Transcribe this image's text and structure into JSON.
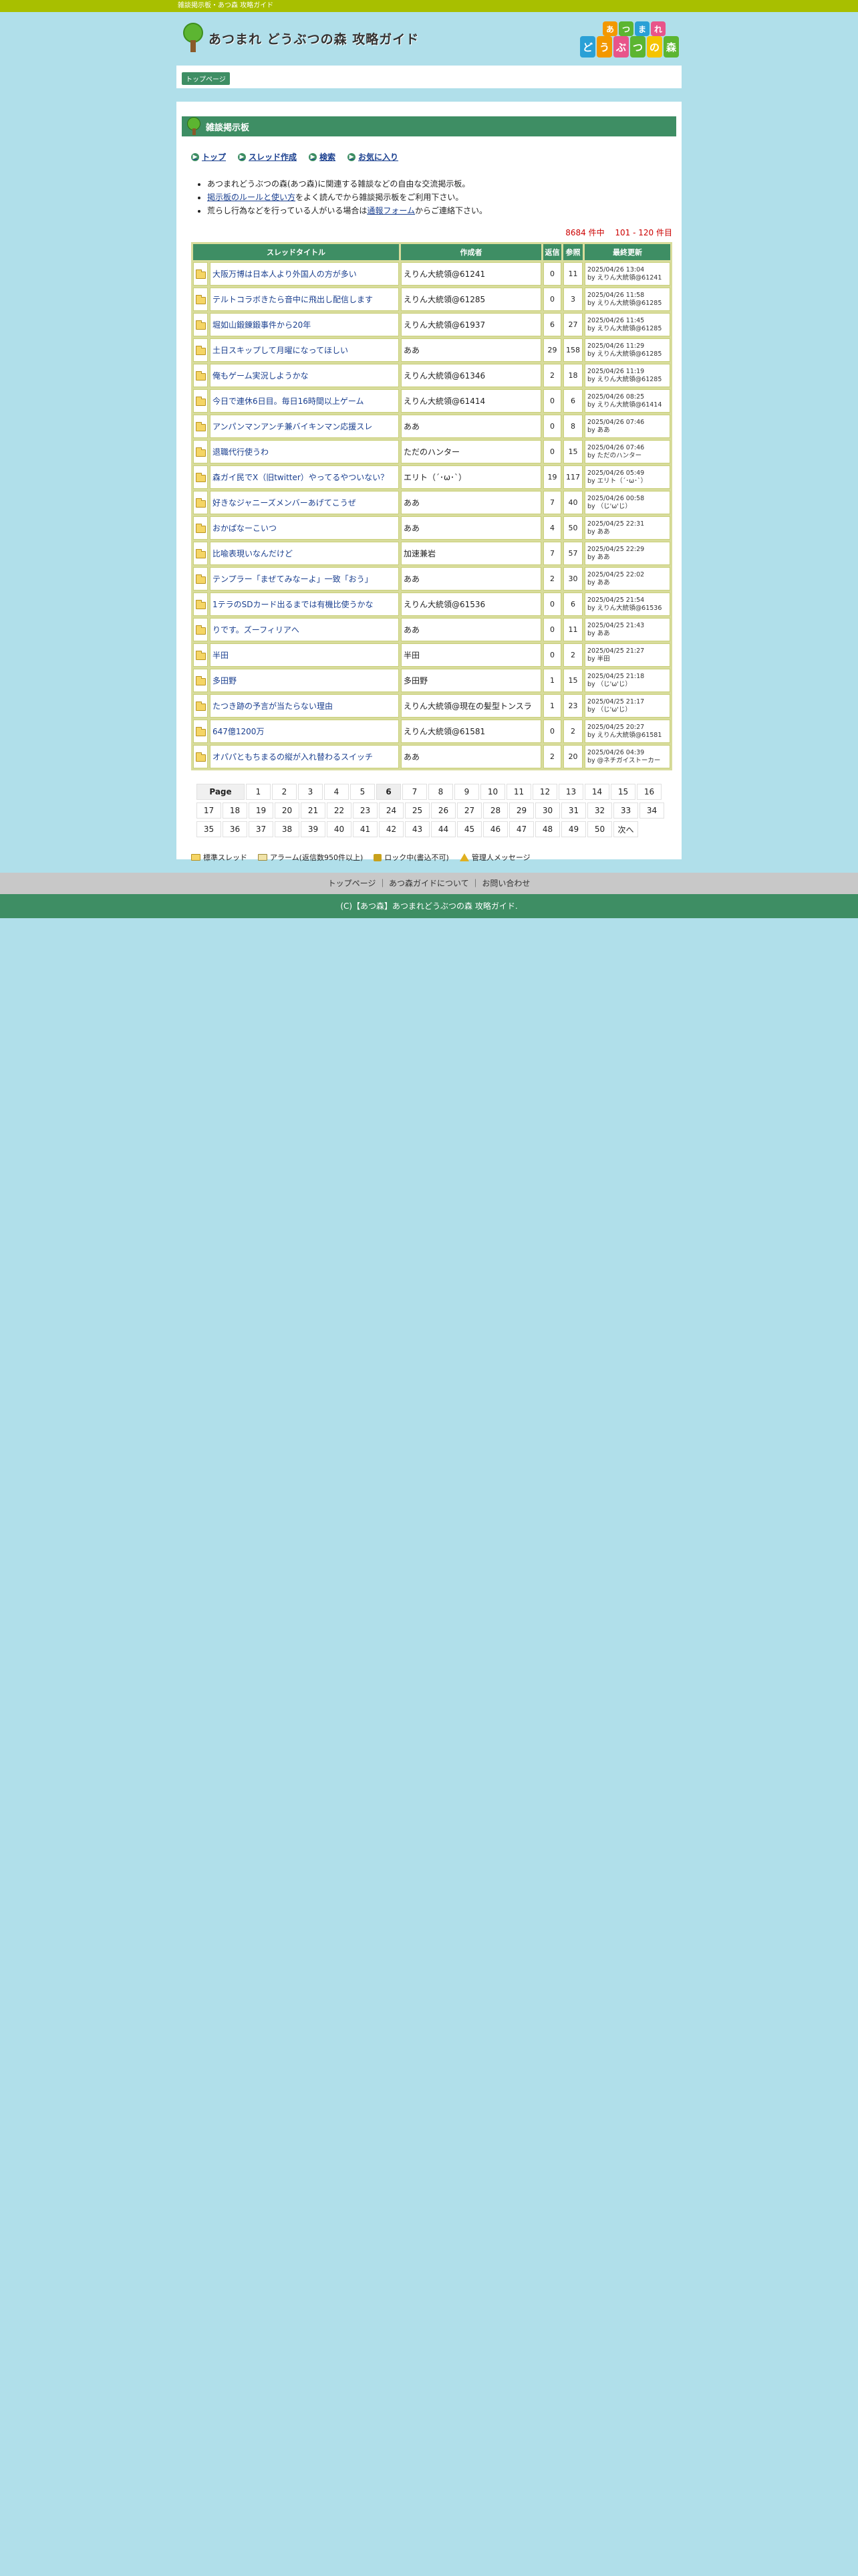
{
  "topbar": {
    "text": "雑談掲示板・あつ森 攻略ガイド"
  },
  "header": {
    "logo_text": "あつまれ どうぶつの森 攻略ガイド",
    "badge_row1": [
      "あ",
      "つ",
      "ま",
      "れ"
    ],
    "badge_row2": [
      "ど",
      "う",
      "ぶ",
      "つ",
      "の",
      "森"
    ],
    "colors": {
      "orange": "#f39800",
      "green": "#5cb531",
      "blue": "#2aa0d6",
      "pink": "#e8548a",
      "yellow": "#f5c400"
    }
  },
  "breadcrumb": {
    "label": "トップページ"
  },
  "section": {
    "title": "雑談掲示板"
  },
  "nav": {
    "items": [
      {
        "label": "トップ"
      },
      {
        "label": "スレッド作成"
      },
      {
        "label": "検索"
      },
      {
        "label": "お気に入り"
      }
    ]
  },
  "notes": {
    "line1": "あつまれどうぶつの森(あつ森)に関連する雑談などの自由な交流掲示板。",
    "line2_link": "掲示板のルールと使い方",
    "line2_rest": "をよく読んでから雑談掲示板をご利用下さい。",
    "line3_pre": "荒らし行為などを行っている人がいる場合は",
    "line3_link": "通報フォーム",
    "line3_post": "からご連絡下さい。"
  },
  "count": {
    "text": "8684 件中 　101 - 120 件目"
  },
  "table": {
    "headers": {
      "title": "スレッドタイトル",
      "author": "作成者",
      "replies": "返信",
      "views": "参照",
      "updated": "最終更新"
    },
    "rows": [
      {
        "title": "大阪万博は日本人より外国人の方が多い",
        "author": "えりん大統領@61241",
        "replies": "0",
        "views": "11",
        "date": "2025/04/26 13:04",
        "by": "by えりん大統領@61241"
      },
      {
        "title": "テルトコラボきたら音中に飛出し配信します",
        "author": "えりん大統領@61285",
        "replies": "0",
        "views": "3",
        "date": "2025/04/26 11:58",
        "by": "by えりん大統領@61285"
      },
      {
        "title": "堀如山鍛錬鍛事件から20年",
        "author": "えりん大統領@61937",
        "replies": "6",
        "views": "27",
        "date": "2025/04/26 11:45",
        "by": "by えりん大統領@61285"
      },
      {
        "title": "土日スキップして月曜になってほしい",
        "author": "ああ",
        "replies": "29",
        "views": "158",
        "date": "2025/04/26 11:29",
        "by": "by えりん大統領@61285"
      },
      {
        "title": "俺もゲーム実況しようかな",
        "author": "えりん大統領@61346",
        "replies": "2",
        "views": "18",
        "date": "2025/04/26 11:19",
        "by": "by えりん大統領@61285"
      },
      {
        "title": "今日で連休6日目。毎日16時間以上ゲーム",
        "author": "えりん大統領@61414",
        "replies": "0",
        "views": "6",
        "date": "2025/04/26 08:25",
        "by": "by えりん大統領@61414"
      },
      {
        "title": "アンパンマンアンチ兼バイキンマン応援スレ",
        "author": "ああ",
        "replies": "0",
        "views": "8",
        "date": "2025/04/26 07:46",
        "by": "by ああ"
      },
      {
        "title": "退職代行使うわ",
        "author": "ただのハンター",
        "replies": "0",
        "views": "15",
        "date": "2025/04/26 07:46",
        "by": "by ただのハンター"
      },
      {
        "title": "森ガイ民でX（旧twitter）やってるやついない？",
        "author": "エリト（´･ω･`）",
        "replies": "19",
        "views": "117",
        "date": "2025/04/26 05:49",
        "by": "by エリト（´･ω･`）"
      },
      {
        "title": "好きなジャニーズメンバーあげてこうぜ",
        "author": "ああ",
        "replies": "7",
        "views": "40",
        "date": "2025/04/26 00:58",
        "by": "by （じ'ω'じ）"
      },
      {
        "title": "おかぱなーこいつ",
        "author": "ああ",
        "replies": "4",
        "views": "50",
        "date": "2025/04/25 22:31",
        "by": "by ああ"
      },
      {
        "title": "比喩表現いなんだけど",
        "author": "加速兼岩",
        "replies": "7",
        "views": "57",
        "date": "2025/04/25 22:29",
        "by": "by ああ"
      },
      {
        "title": "テンプラー「まぜてみなーよ」一致「おう」",
        "author": "ああ",
        "replies": "2",
        "views": "30",
        "date": "2025/04/25 22:02",
        "by": "by ああ"
      },
      {
        "title": "1テラのSDカード出るまでは有機比使うかな",
        "author": "えりん大統領@61536",
        "replies": "0",
        "views": "6",
        "date": "2025/04/25 21:54",
        "by": "by えりん大統領@61536"
      },
      {
        "title": "りです。ズーフィリアへ",
        "author": "ああ",
        "replies": "0",
        "views": "11",
        "date": "2025/04/25 21:43",
        "by": "by ああ"
      },
      {
        "title": "半田",
        "author": "半田",
        "replies": "0",
        "views": "2",
        "date": "2025/04/25 21:27",
        "by": "by 半田"
      },
      {
        "title": "多田野",
        "author": "多田野",
        "replies": "1",
        "views": "15",
        "date": "2025/04/25 21:18",
        "by": "by （じ'ω'じ）"
      },
      {
        "title": "たつき跡の予言が当たらない理由",
        "author": "えりん大統領@現在の髪型トンスラ",
        "replies": "1",
        "views": "23",
        "date": "2025/04/25 21:17",
        "by": "by （じ'ω'じ）"
      },
      {
        "title": "647億1200万",
        "author": "えりん大統領@61581",
        "replies": "0",
        "views": "2",
        "date": "2025/04/25 20:27",
        "by": "by えりん大統領@61581"
      },
      {
        "title": "オパパともちまるの縦が入れ替わるスイッチ",
        "author": "ああ",
        "replies": "2",
        "views": "20",
        "date": "2025/04/26 04:39",
        "by": "by @ネチガイストーカー"
      }
    ]
  },
  "pager": {
    "label": "Page",
    "current": "6",
    "row1": [
      "1",
      "2",
      "3",
      "4",
      "5",
      "6",
      "7",
      "8",
      "9",
      "10",
      "11",
      "12",
      "13",
      "14",
      "15",
      "16"
    ],
    "row2": [
      "17",
      "18",
      "19",
      "20",
      "21",
      "22",
      "23",
      "24",
      "25",
      "26",
      "27",
      "28",
      "29",
      "30",
      "31",
      "32",
      "33",
      "34"
    ],
    "row3": [
      "35",
      "36",
      "37",
      "38",
      "39",
      "40",
      "41",
      "42",
      "43",
      "44",
      "45",
      "46",
      "47",
      "48",
      "49",
      "50",
      "次へ"
    ]
  },
  "legend": {
    "normal": "標準スレッド",
    "alarm": "アラーム(返信数950件以上)",
    "lock": "ロック中(書込不可)",
    "admin": "管理人メッセージ"
  },
  "footer": {
    "links": "トップページ ｜ あつ森ガイドについて ｜ お問い合わせ",
    "copy": "(C)【あつ森】あつまれどうぶつの森 攻略ガイド."
  }
}
